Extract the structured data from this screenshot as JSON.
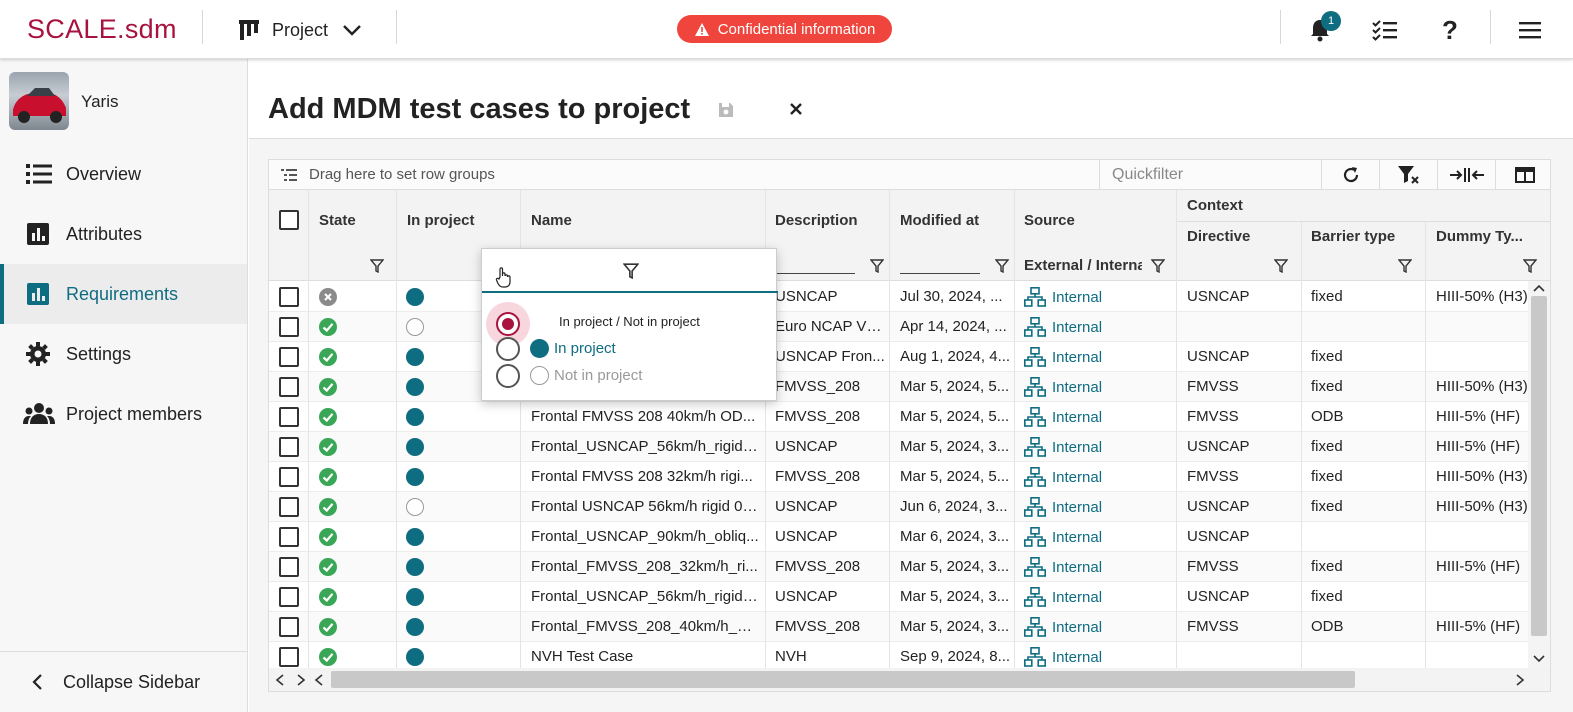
{
  "header": {
    "logo": "SCALE.sdm",
    "project_label": "Project",
    "confidential": "Confidential information",
    "notification_count": "1",
    "colors": {
      "brand": "#a8123e",
      "accent": "#0f6d82",
      "alert": "#f0453d",
      "success": "#3aa757"
    }
  },
  "sidebar": {
    "vehicle_name": "Yaris",
    "items": [
      {
        "label": "Overview",
        "icon": "list-icon"
      },
      {
        "label": "Attributes",
        "icon": "bar-chart-icon"
      },
      {
        "label": "Requirements",
        "icon": "bar-chart-icon",
        "active": true
      },
      {
        "label": "Settings",
        "icon": "gear-icon"
      },
      {
        "label": "Project members",
        "icon": "people-icon"
      }
    ],
    "collapse_label": "Collapse Sidebar"
  },
  "page": {
    "title": "Add MDM test cases to project"
  },
  "grid": {
    "toolbar": {
      "row_groups": "Drag here to set row groups",
      "quickfilter_placeholder": "Quickfilter"
    },
    "columns": {
      "state": "State",
      "in_project": "In project",
      "name": "Name",
      "description": "Description",
      "modified_at": "Modified at",
      "source": "Source",
      "context": "Context",
      "directive": "Directive",
      "barrier_type": "Barrier type",
      "dummy_type": "Dummy Ty..."
    },
    "source_filter_value": "External / Interna",
    "rows": [
      {
        "state": "x",
        "in": true,
        "name": "",
        "desc": "USNCAP",
        "mod": "Jul 30, 2024, ...",
        "src": "Internal",
        "dir": "USNCAP",
        "bar": "fixed",
        "dum": "HIII-50% (H3)"
      },
      {
        "state": "ok",
        "in": false,
        "name": "",
        "desc": "Euro NCAP VTC",
        "mod": "Apr 14, 2024, ...",
        "src": "Internal",
        "dir": "",
        "bar": "",
        "dum": ""
      },
      {
        "state": "ok",
        "in": true,
        "name": "",
        "desc": "USNCAP Fron...",
        "mod": "Aug 1, 2024, 4...",
        "src": "Internal",
        "dir": "USNCAP",
        "bar": "fixed",
        "dum": ""
      },
      {
        "state": "ok",
        "in": true,
        "name": "",
        "desc": "FMVSS_208",
        "mod": "Mar 5, 2024, 5...",
        "src": "Internal",
        "dir": "FMVSS",
        "bar": "fixed",
        "dum": "HIII-50% (H3)"
      },
      {
        "state": "ok",
        "in": true,
        "name": "Frontal FMVSS 208 40km/h OD...",
        "desc": "FMVSS_208",
        "mod": "Mar 5, 2024, 5...",
        "src": "Internal",
        "dir": "FMVSS",
        "bar": "ODB",
        "dum": "HIII-5% (HF)"
      },
      {
        "state": "ok",
        "in": true,
        "name": "Frontal_USNCAP_56km/h_rigid_...",
        "desc": "USNCAP",
        "mod": "Mar 5, 2024, 3...",
        "src": "Internal",
        "dir": "USNCAP",
        "bar": "fixed",
        "dum": "HIII-5% (HF)"
      },
      {
        "state": "ok",
        "in": true,
        "name": "Frontal FMVSS 208 32km/h rigi...",
        "desc": "FMVSS_208",
        "mod": "Mar 5, 2024, 5...",
        "src": "Internal",
        "dir": "FMVSS",
        "bar": "fixed",
        "dum": "HIII-50% (H3)"
      },
      {
        "state": "ok",
        "in": false,
        "name": "Frontal USNCAP 56km/h rigid 0°...",
        "desc": "USNCAP",
        "mod": "Jun 6, 2024, 3...",
        "src": "Internal",
        "dir": "USNCAP",
        "bar": "fixed",
        "dum": "HIII-50% (H3)"
      },
      {
        "state": "ok",
        "in": true,
        "name": "Frontal_USNCAP_90km/h_obliq...",
        "desc": "USNCAP",
        "mod": "Mar 6, 2024, 3...",
        "src": "Internal",
        "dir": "USNCAP",
        "bar": "",
        "dum": ""
      },
      {
        "state": "ok",
        "in": true,
        "name": "Frontal_FMVSS_208_32km/h_ri...",
        "desc": "FMVSS_208",
        "mod": "Mar 5, 2024, 3...",
        "src": "Internal",
        "dir": "FMVSS",
        "bar": "fixed",
        "dum": "HIII-5% (HF)"
      },
      {
        "state": "ok",
        "in": true,
        "name": "Frontal_USNCAP_56km/h_rigid_...",
        "desc": "USNCAP",
        "mod": "Mar 5, 2024, 3...",
        "src": "Internal",
        "dir": "USNCAP",
        "bar": "fixed",
        "dum": ""
      },
      {
        "state": "ok",
        "in": true,
        "name": "Frontal_FMVSS_208_40km/h_O...",
        "desc": "FMVSS_208",
        "mod": "Mar 5, 2024, 3...",
        "src": "Internal",
        "dir": "FMVSS",
        "bar": "ODB",
        "dum": "HIII-5% (HF)"
      },
      {
        "state": "ok",
        "in": true,
        "name": "NVH Test Case",
        "desc": "NVH",
        "mod": "Sep 9, 2024, 8...",
        "src": "Internal",
        "dir": "",
        "bar": "",
        "dum": ""
      }
    ]
  },
  "filter_popup": {
    "options": [
      {
        "label": "In project / Not in project",
        "selected": true
      },
      {
        "label": "In project",
        "selected": false
      },
      {
        "label": "Not in project",
        "selected": false
      }
    ]
  }
}
